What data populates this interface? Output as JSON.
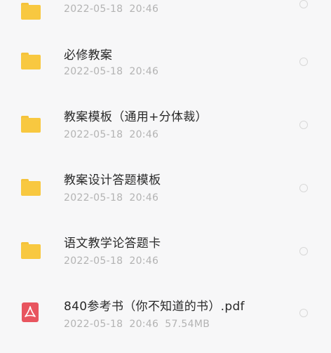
{
  "files": [
    {
      "title": "",
      "date": "2022-05-18",
      "time": "20:46",
      "size": "",
      "icon": "folder-icon"
    },
    {
      "title": "必修教案",
      "date": "2022-05-18",
      "time": "20:46",
      "size": "",
      "icon": "folder-icon"
    },
    {
      "title": "教案模板（通用+分体裁）",
      "date": "2022-05-18",
      "time": "20:46",
      "size": "",
      "icon": "folder-icon"
    },
    {
      "title": "教案设计答题模板",
      "date": "2022-05-18",
      "time": "20:46",
      "size": "",
      "icon": "folder-icon"
    },
    {
      "title": "语文教学论答题卡",
      "date": "2022-05-18",
      "time": "20:46",
      "size": "",
      "icon": "folder-icon"
    },
    {
      "title": "840参考书（你不知道的书）.pdf",
      "date": "2022-05-18",
      "time": "20:46",
      "size": "57.54MB",
      "icon": "pdf-icon"
    }
  ],
  "colors": {
    "folder": "#f8c840",
    "pdf": "#e8555f",
    "title_text": "#2a2a2a",
    "meta_text": "#b3b3b3"
  }
}
